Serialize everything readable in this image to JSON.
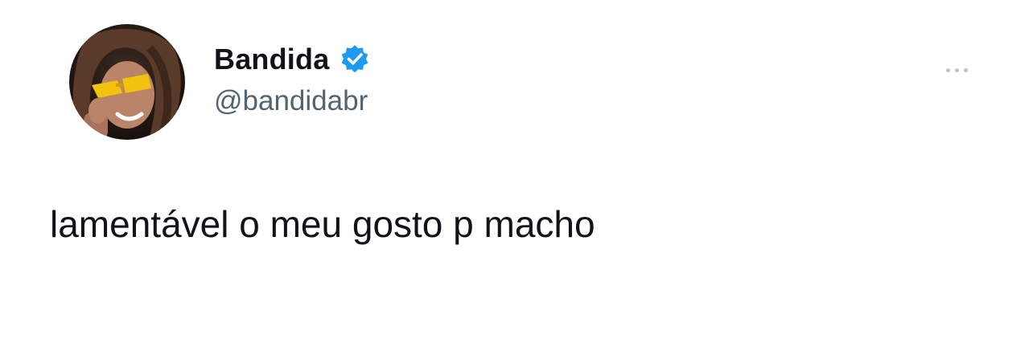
{
  "tweet": {
    "display_name": "Bandida",
    "handle": "@bandidabr",
    "verified": true,
    "text": "lamentável o meu gosto p macho",
    "icons": {
      "avatar": "profile-photo",
      "verified": "verified-badge-icon",
      "more": "more-options-icon"
    },
    "colors": {
      "name": "#0f1419",
      "handle": "#536471",
      "verified_badge": "#1d9bf0",
      "background": "#ffffff",
      "more_dots": "#b9c3cc"
    }
  }
}
